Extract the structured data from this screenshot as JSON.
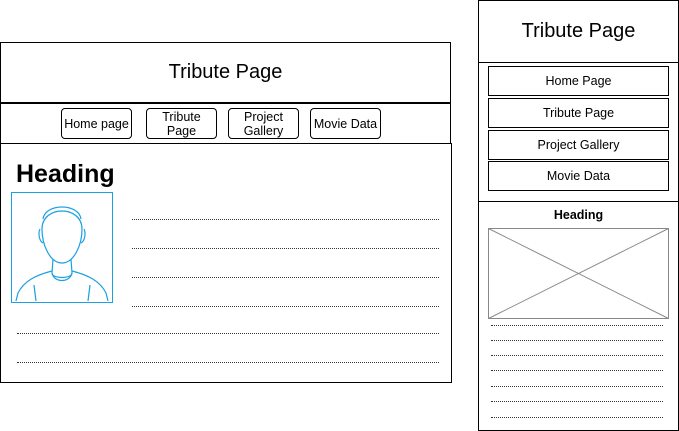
{
  "desktop": {
    "title": "Tribute Page",
    "nav": [
      "Home page",
      "Tribute\nPage",
      "Project\nGallery",
      "Movie Data"
    ],
    "heading": "Heading"
  },
  "mobile": {
    "title": "Tribute Page",
    "nav": [
      "Home Page",
      "Tribute Page",
      "Project Gallery",
      "Movie Data"
    ],
    "heading": "Heading"
  },
  "colors": {
    "avatar": "#1ba1e2",
    "placeholder": "#888888"
  },
  "icons": {
    "avatar": "user-avatar-icon",
    "image_placeholder": "image-placeholder"
  }
}
